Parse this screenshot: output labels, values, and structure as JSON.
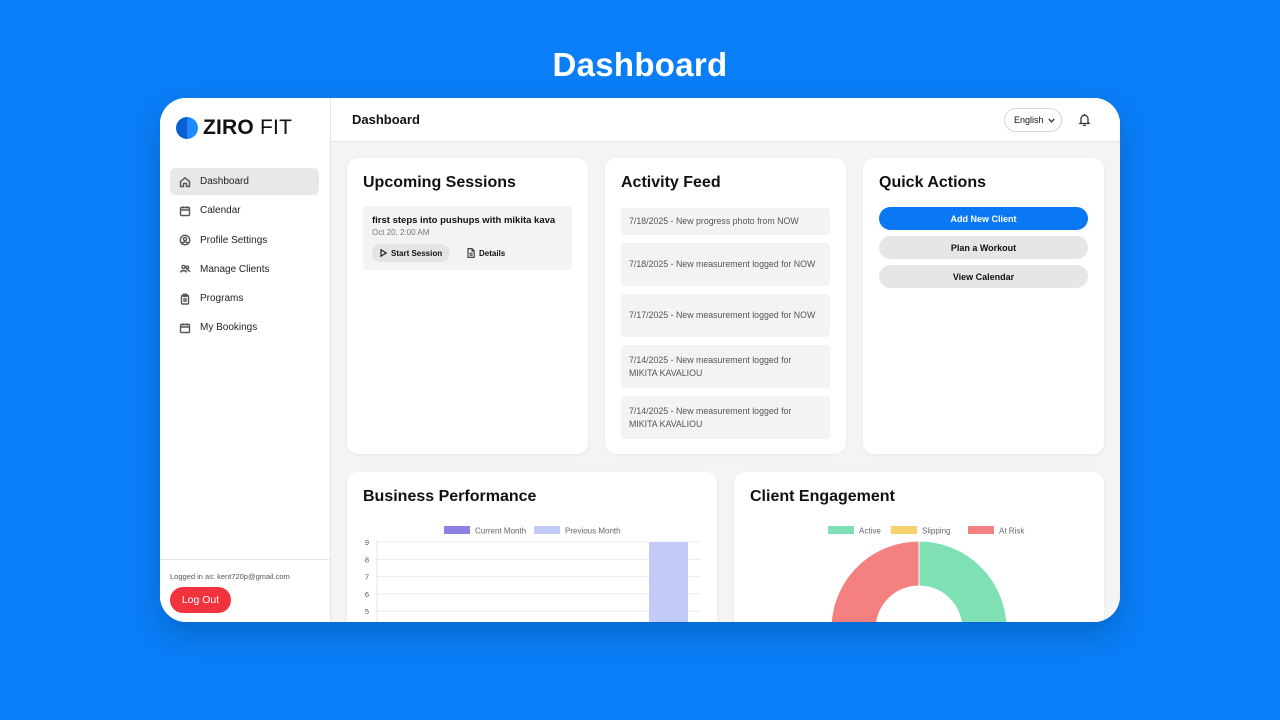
{
  "page": {
    "title": "Dashboard"
  },
  "brand": {
    "strong": "ZIRO",
    "light": " FIT"
  },
  "sidebar": {
    "items": [
      {
        "label": "Dashboard",
        "icon": "home-icon",
        "active": true
      },
      {
        "label": "Calendar",
        "icon": "calendar-icon",
        "active": false
      },
      {
        "label": "Profile Settings",
        "icon": "user-circle-icon",
        "active": false
      },
      {
        "label": "Manage Clients",
        "icon": "users-icon",
        "active": false
      },
      {
        "label": "Programs",
        "icon": "clipboard-icon",
        "active": false
      },
      {
        "label": "My Bookings",
        "icon": "calendar-icon",
        "active": false
      }
    ],
    "logged_in": "Logged in as: kent720p@gmail.com",
    "logout_label": "Log Out"
  },
  "topbar": {
    "title": "Dashboard",
    "language": "English"
  },
  "upcoming": {
    "title": "Upcoming Sessions",
    "session": {
      "name": "first steps into pushups with mikita kava",
      "date": "Oct 20, 2:00 AM",
      "start_label": "Start Session",
      "details_label": "Details"
    }
  },
  "activity": {
    "title": "Activity Feed",
    "items": [
      "7/18/2025 - New progress photo from NOW",
      "7/18/2025 - New measurement logged for NOW",
      "7/17/2025 - New measurement logged for NOW",
      "7/14/2025 - New measurement logged for MIKITA KAVALIOU",
      "7/14/2025 - New measurement logged for MIKITA KAVALIOU"
    ]
  },
  "actions": {
    "title": "Quick Actions",
    "add_client": "Add New Client",
    "plan_workout": "Plan a Workout",
    "view_calendar": "View Calendar"
  },
  "colors": {
    "background": "#0a7ef7",
    "accent": "#0a78f5",
    "logout": "#f2333e",
    "current_month": "#8c82e6",
    "previous_month": "#c2cbf8",
    "active": "#7fe0b5",
    "slipping": "#f5d06b",
    "at_risk": "#f4807f"
  },
  "chart_data": [
    {
      "type": "bar",
      "title": "Business Performance",
      "series": [
        {
          "name": "Current Month",
          "values": [
            0
          ]
        },
        {
          "name": "Previous Month",
          "values": [
            9
          ]
        }
      ],
      "yticks": [
        "9",
        "8",
        "7",
        "6",
        "5"
      ],
      "ylim": [
        0,
        9
      ],
      "legend": "top",
      "grid": true
    },
    {
      "type": "pie",
      "title": "Client Engagement",
      "labels": [
        "Active",
        "Slipping",
        "At Risk"
      ],
      "values": [
        1,
        0,
        1
      ],
      "legend": "top"
    }
  ]
}
